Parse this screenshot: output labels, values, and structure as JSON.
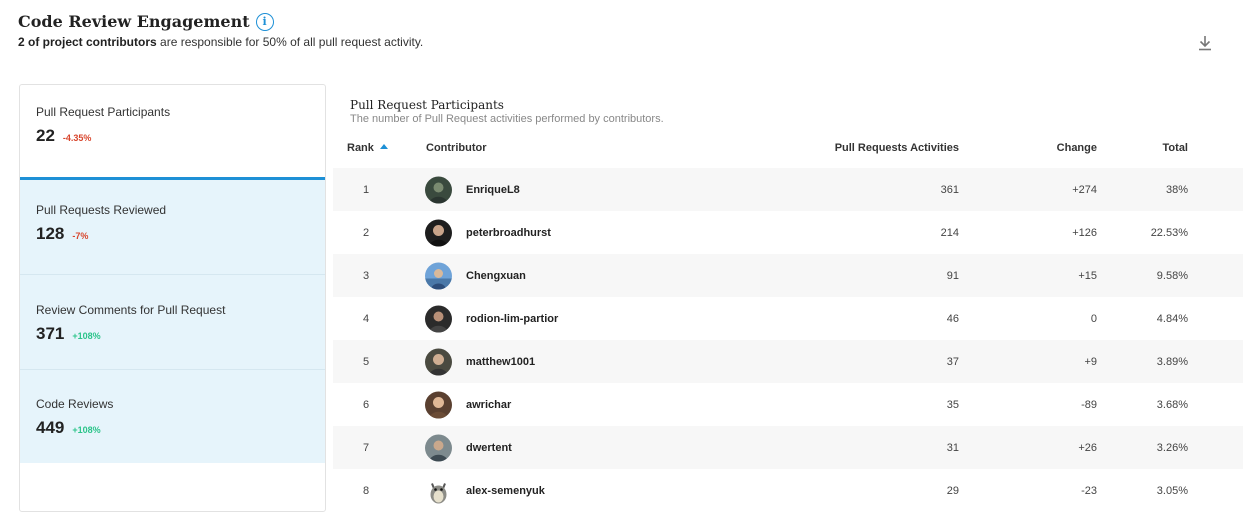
{
  "header": {
    "title": "Code Review Engagement",
    "subtitle_bold": "2 of project contributors",
    "subtitle_rest": " are responsible for 50% of all pull request activity."
  },
  "metrics": [
    {
      "label": "Pull Request Participants",
      "value": "22",
      "change": "-4.35%"
    },
    {
      "label": "Pull Requests Reviewed",
      "value": "128",
      "change": "-7%"
    },
    {
      "label": "Review Comments for Pull Request",
      "value": "371",
      "change": "+108%"
    },
    {
      "label": "Code Reviews",
      "value": "449",
      "change": "+108%"
    }
  ],
  "panel": {
    "title": "Pull Request Participants",
    "description": "The number of Pull Request activities performed by contributors."
  },
  "table": {
    "headers": {
      "rank": "Rank",
      "contributor": "Contributor",
      "activities": "Pull Requests Activities",
      "change": "Change",
      "total": "Total"
    },
    "rows": [
      {
        "rank": "1",
        "name": "EnriqueL8",
        "activities": "361",
        "change": "+274",
        "total": "38%"
      },
      {
        "rank": "2",
        "name": "peterbroadhurst",
        "activities": "214",
        "change": "+126",
        "total": "22.53%"
      },
      {
        "rank": "3",
        "name": "Chengxuan",
        "activities": "91",
        "change": "+15",
        "total": "9.58%"
      },
      {
        "rank": "4",
        "name": "rodion-lim-partior",
        "activities": "46",
        "change": "0",
        "total": "4.84%"
      },
      {
        "rank": "5",
        "name": "matthew1001",
        "activities": "37",
        "change": "+9",
        "total": "3.89%"
      },
      {
        "rank": "6",
        "name": "awrichar",
        "activities": "35",
        "change": "-89",
        "total": "3.68%"
      },
      {
        "rank": "7",
        "name": "dwertent",
        "activities": "31",
        "change": "+26",
        "total": "3.26%"
      },
      {
        "rank": "8",
        "name": "alex-semenyuk",
        "activities": "29",
        "change": "-23",
        "total": "3.05%"
      }
    ]
  },
  "colors": {
    "accent": "#1e90d6",
    "positive": "#2bc48a",
    "negative": "#d8452c",
    "active_bg": "#e6f4fb"
  }
}
